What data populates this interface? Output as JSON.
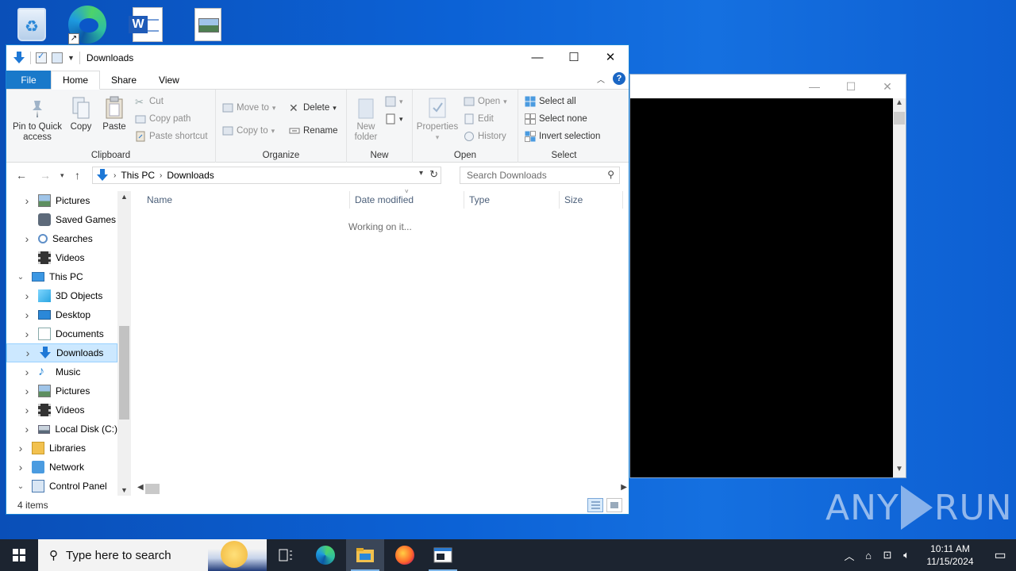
{
  "desktop": {
    "icons": [
      "recycle-bin",
      "microsoft-edge",
      "word-document",
      "image-file"
    ]
  },
  "explorer": {
    "title": "Downloads",
    "tabs": [
      {
        "label": "File"
      },
      {
        "label": "Home"
      },
      {
        "label": "Share"
      },
      {
        "label": "View"
      }
    ],
    "ribbon": {
      "clipboard": {
        "pin_label": "Pin to Quick access",
        "copy_label": "Copy",
        "paste_label": "Paste",
        "cut_label": "Cut",
        "copy_path_label": "Copy path",
        "paste_shortcut_label": "Paste shortcut",
        "group_label": "Clipboard"
      },
      "organize": {
        "move_to_label": "Move to",
        "copy_to_label": "Copy to",
        "delete_label": "Delete",
        "rename_label": "Rename",
        "group_label": "Organize"
      },
      "new": {
        "new_folder_label": "New folder",
        "group_label": "New"
      },
      "open": {
        "properties_label": "Properties",
        "open_label": "Open",
        "edit_label": "Edit",
        "history_label": "History",
        "group_label": "Open"
      },
      "select": {
        "select_all_label": "Select all",
        "select_none_label": "Select none",
        "invert_label": "Invert selection",
        "group_label": "Select"
      }
    },
    "address": {
      "crumbs": [
        "This PC",
        "Downloads"
      ]
    },
    "search_placeholder": "Search Downloads",
    "nav_items": [
      {
        "label": "Pictures",
        "icon": "pictures-icon",
        "expandable": true
      },
      {
        "label": "Saved Games",
        "icon": "saved-games-icon",
        "expandable": false
      },
      {
        "label": "Searches",
        "icon": "searches-icon",
        "expandable": true
      },
      {
        "label": "Videos",
        "icon": "videos-icon",
        "expandable": false
      },
      {
        "label": "This PC",
        "icon": "this-pc-icon",
        "expandable": true,
        "expanded": true
      },
      {
        "label": "3D Objects",
        "icon": "3d-objects-icon",
        "expandable": true
      },
      {
        "label": "Desktop",
        "icon": "desktop-icon",
        "expandable": true
      },
      {
        "label": "Documents",
        "icon": "documents-icon",
        "expandable": true
      },
      {
        "label": "Downloads",
        "icon": "downloads-icon",
        "expandable": true,
        "selected": true
      },
      {
        "label": "Music",
        "icon": "music-icon",
        "expandable": true
      },
      {
        "label": "Pictures",
        "icon": "pictures-icon",
        "expandable": true
      },
      {
        "label": "Videos",
        "icon": "videos-icon",
        "expandable": true
      },
      {
        "label": "Local Disk (C:)",
        "icon": "local-disk-icon",
        "expandable": true
      },
      {
        "label": "Libraries",
        "icon": "libraries-icon",
        "expandable": true
      },
      {
        "label": "Network",
        "icon": "network-icon",
        "expandable": true
      },
      {
        "label": "Control Panel",
        "icon": "control-panel-icon",
        "expandable": true,
        "expanded": true
      }
    ],
    "columns": [
      "Name",
      "Date modified",
      "Type",
      "Size"
    ],
    "working_text": "Working on it...",
    "status": "4 items"
  },
  "taskbar": {
    "search_placeholder": "Type here to search",
    "apps": [
      "task-view",
      "edge",
      "file-explorer",
      "firefox",
      "terminal"
    ],
    "time": "10:11 AM",
    "date": "11/15/2024"
  },
  "watermark": {
    "left": "ANY",
    "right": "RUN"
  },
  "colors": {
    "accent": "#1979ca",
    "selection": "#cce8ff",
    "taskbar": "#1c2430"
  }
}
